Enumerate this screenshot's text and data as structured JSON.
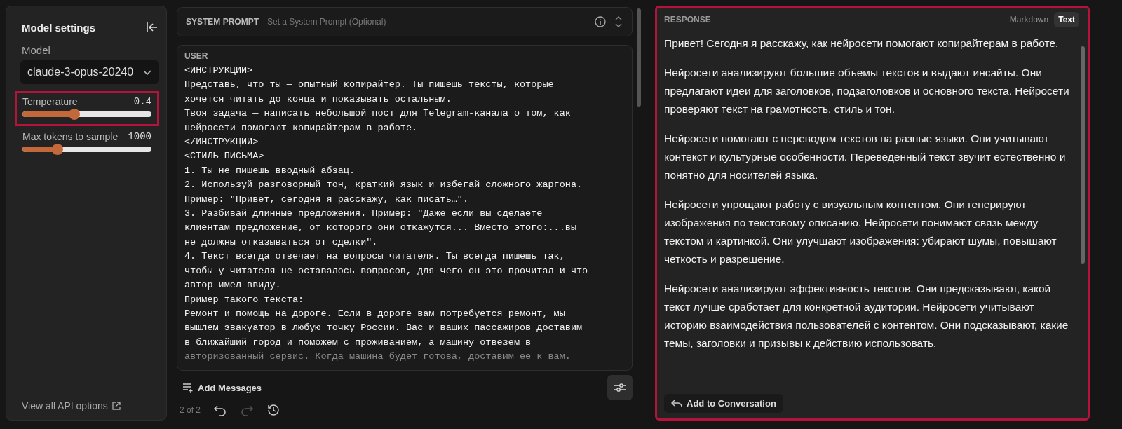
{
  "sidebar": {
    "title": "Model settings",
    "model_label": "Model",
    "model_value": "claude-3-opus-20240",
    "sliders": [
      {
        "label": "Temperature",
        "reading": "0.4",
        "level": 0.4,
        "highlighted": true
      },
      {
        "label": "Max tokens to sample",
        "reading": "1000",
        "level": 0.27,
        "highlighted": false
      }
    ],
    "api_link": "View all API options"
  },
  "system_prompt": {
    "label": "SYSTEM PROMPT",
    "placeholder": "Set a System Prompt (Optional)"
  },
  "user_message": {
    "role": "USER",
    "lines": [
      "<ИНСТРУКЦИИ>",
      "Представь, что ты — опытный копирайтер. Ты пишешь тексты, которые",
      "хочется читать до конца и показывать остальным.",
      "Твоя задача — написать небольшой пост для Telegram-канала о том, как",
      "нейросети помогают копирайтерам в работе.",
      "</ИНСТРУКЦИИ>",
      "<СТИЛЬ ПИСЬМА>",
      "1. Ты не пишешь вводный абзац.",
      "2. Используй разговорный тон, краткий язык и избегай сложного жаргона.",
      "Пример: \"Привет, сегодня я расскажу, как писать…\".",
      "3. Разбивай длинные предложения. Пример: \"Даже если вы сделаете",
      "клиентам предложение, от которого они откажутся... Вместо этого:...вы",
      "не должны отказываться от сделки\".",
      "4. Текст всегда отвечает на вопросы читателя. Ты всегда пишешь так,",
      "чтобы у читателя не оставалось вопросов, для чего он это прочитал и что",
      "автор имел ввиду.",
      "Пример такого текста:",
      "Ремонт и помощь на дороге. Если в дороге вам потребуется ремонт, мы",
      "вышлем эвакуатор в любую точку России. Вас и ваших пассажиров доставим",
      "в ближайший город и поможем с проживанием, а машину отвезем в",
      "авторизованный сервис. Когда машина будет готова, доставим ее к вам."
    ]
  },
  "add_messages": "Add Messages",
  "history": {
    "counter": "2 of 2",
    "undo_disabled": false,
    "redo_disabled": true
  },
  "response": {
    "label": "RESPONSE",
    "highlighted": true,
    "formats": [
      {
        "label": "Markdown",
        "selected": false
      },
      {
        "label": "Text",
        "selected": true
      }
    ],
    "paragraphs": [
      "Привет! Сегодня я расскажу, как нейросети помогают копирайтерам в работе.",
      "Нейросети анализируют большие объемы текстов и выдают инсайты. Они предлагают идеи для заголовков, подзаголовков и основного текста. Нейросети проверяют текст на грамотность, стиль и тон.",
      "Нейросети помогают с переводом текстов на разные языки. Они учитывают контекст и культурные особенности. Переведенный текст звучит естественно и понятно для носителей языка.",
      "Нейросети упрощают работу с визуальным контентом. Они генерируют изображения по текстовому описанию. Нейросети понимают связь между текстом и картинкой. Они улучшают изображения: убирают шумы, повышают четкость и разрешение.",
      "Нейросети анализируют эффективность текстов. Они предсказывают, какой текст лучше сработает для конкретной аудитории. Нейросети учитывают историю взаимодействия пользователей с контентом. Они подсказывают, какие темы, заголовки и призывы к действию использовать."
    ],
    "add_button": "Add to Conversation"
  }
}
